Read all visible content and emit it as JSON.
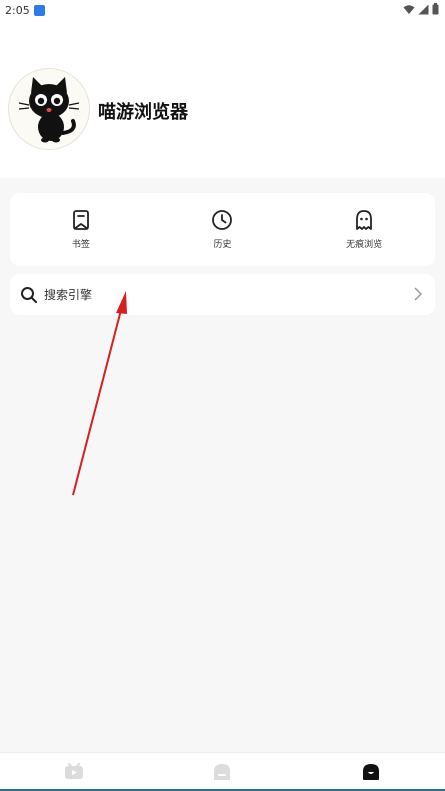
{
  "status_bar": {
    "time": "2:05",
    "icons": [
      "app-notification-icon",
      "wifi-icon",
      "signal-icon",
      "battery-icon"
    ]
  },
  "header": {
    "app_name": "喵游浏览器",
    "avatar": "black-cat-logo-icon"
  },
  "quick_actions": [
    {
      "label": "书签",
      "icon": "bookmark-icon"
    },
    {
      "label": "历史",
      "icon": "clock-icon"
    },
    {
      "label": "无痕浏览",
      "icon": "ghost-icon"
    }
  ],
  "search_engine": {
    "label": "搜索引擎",
    "icon": "search-icon",
    "trailing_icon": "chevron-right-icon"
  },
  "bottom_nav": [
    {
      "icon": "video-tab-icon",
      "active": false
    },
    {
      "icon": "home-tab-icon",
      "active": false
    },
    {
      "icon": "profile-tab-icon",
      "active": true
    }
  ],
  "colors": {
    "background": "#f7f7f7",
    "card": "#ffffff",
    "annotation_arrow": "#d62020",
    "active_tab": "#111111",
    "inactive_tab": "#d9d9d9"
  }
}
